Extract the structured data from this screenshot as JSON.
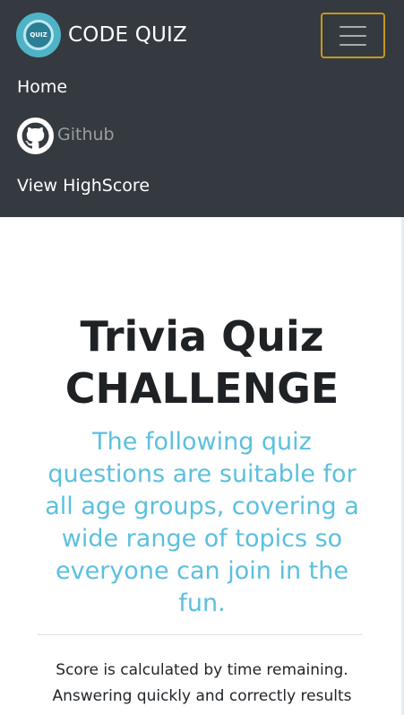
{
  "navbar": {
    "brand_logo_text": "QUIZ",
    "brand_text": "CODE QUIZ",
    "items": {
      "home": "Home",
      "github": "Github",
      "highscore": "View HighScore"
    }
  },
  "hero": {
    "title_line1": "Trivia Quiz",
    "title_line2": "CHALLENGE",
    "lead": "The following quiz questions are suitable for all age groups, covering a wide range of topics so everyone can join in the fun.",
    "description": "Score is calculated by time remaining. Answering quickly and correctly results"
  },
  "colors": {
    "navbar_bg": "#343a40",
    "toggler_border": "#c8961e",
    "lead_text": "#5bc0de",
    "title_text": "#1f2225"
  },
  "icons": {
    "logo": "quiz-logo",
    "menu": "hamburger-icon",
    "github": "github-icon"
  }
}
